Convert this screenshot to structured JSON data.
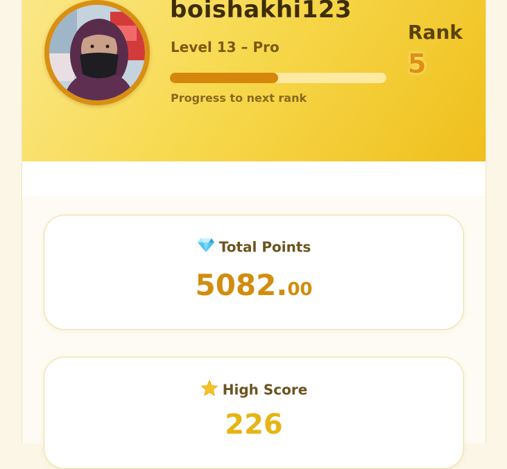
{
  "profile": {
    "username": "boishakhi123",
    "level": "Level 13 – Pro",
    "progress": 0.5,
    "progress_label": "Progress to next rank",
    "rank_label": "Rank",
    "rank_value": "5"
  },
  "cards": {
    "total_points": {
      "title": "Total Points",
      "icon": "diamond-icon",
      "value_int": "5082.",
      "value_dec": "00"
    },
    "high_score": {
      "title": "High Score",
      "icon": "star-icon",
      "value": "226"
    }
  },
  "colors": {
    "header_start": "#fbe787",
    "header_end": "#efbf1c",
    "progress_fill": "#d5860b",
    "accent": "#d18d0f"
  }
}
